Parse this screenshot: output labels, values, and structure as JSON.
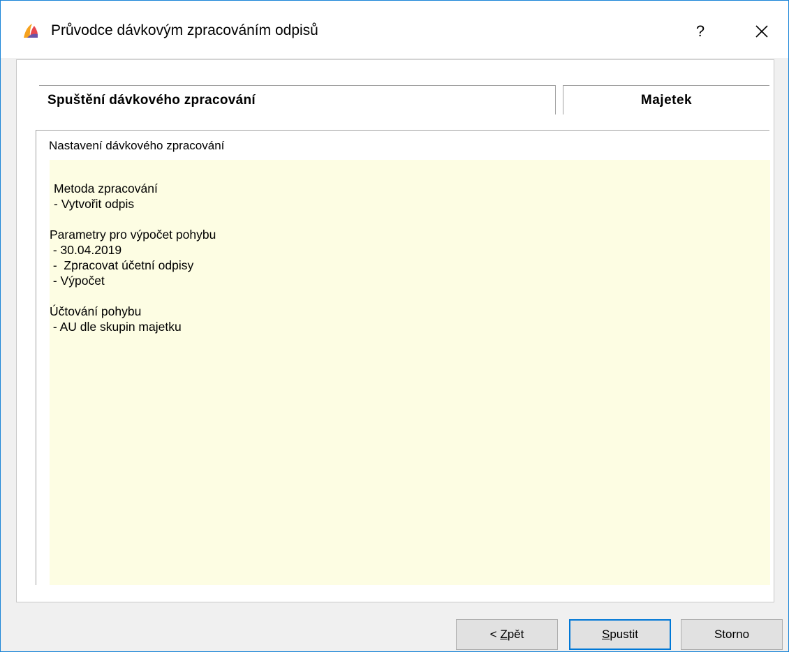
{
  "window": {
    "title": "Průvodce dávkovým zpracováním odpisů",
    "help_label": "?",
    "accent_color": "#0078d7"
  },
  "step": {
    "title": "Spuštění dávkového zpracování",
    "module": "Majetek"
  },
  "settings": {
    "group_label": "Nastavení dávkového zpracování",
    "sections": [
      {
        "heading": "Metoda zpracování",
        "items": [
          "- Vytvořit odpis"
        ]
      },
      {
        "heading": "Parametry pro výpočet pohybu",
        "items": [
          " - 30.04.2019",
          " -  Zpracovat účetní odpisy",
          " - Výpočet"
        ]
      },
      {
        "heading": "Účtování pohybu",
        "items": [
          " - AU dle skupin majetku"
        ]
      }
    ],
    "background_color": "#fdfde3"
  },
  "buttons": {
    "back": {
      "prefix": "< ",
      "mnemonic": "Z",
      "rest": "pět"
    },
    "run": {
      "mnemonic": "S",
      "rest": "pustit"
    },
    "cancel": {
      "label": "Storno"
    }
  },
  "icons": {
    "app": "app-logo-icon",
    "close": "close-icon"
  }
}
